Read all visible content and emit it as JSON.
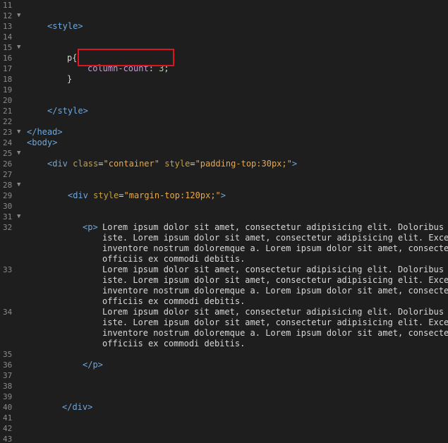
{
  "editor": {
    "lines": [
      {
        "num": "11",
        "fold": false
      },
      {
        "num": "12",
        "fold": true
      },
      {
        "num": "13",
        "fold": false
      },
      {
        "num": "14",
        "fold": false
      },
      {
        "num": "15",
        "fold": true
      },
      {
        "num": "16",
        "fold": false
      },
      {
        "num": "17",
        "fold": false
      },
      {
        "num": "18",
        "fold": false
      },
      {
        "num": "19",
        "fold": false
      },
      {
        "num": "20",
        "fold": false
      },
      {
        "num": "21",
        "fold": false
      },
      {
        "num": "22",
        "fold": false
      },
      {
        "num": "23",
        "fold": true
      },
      {
        "num": "24",
        "fold": false
      },
      {
        "num": "25",
        "fold": true
      },
      {
        "num": "26",
        "fold": false
      },
      {
        "num": "27",
        "fold": false
      },
      {
        "num": "28",
        "fold": true
      },
      {
        "num": "29",
        "fold": false
      },
      {
        "num": "30",
        "fold": false
      },
      {
        "num": "31",
        "fold": true
      },
      {
        "num": "32",
        "fold": false
      },
      {
        "num": "33",
        "fold": false
      },
      {
        "num": "34",
        "fold": false
      },
      {
        "num": "35",
        "fold": false
      },
      {
        "num": "36",
        "fold": false
      },
      {
        "num": "37",
        "fold": false
      },
      {
        "num": "38",
        "fold": false
      },
      {
        "num": "39",
        "fold": false
      },
      {
        "num": "40",
        "fold": false
      },
      {
        "num": "41",
        "fold": false
      },
      {
        "num": "42",
        "fold": false
      },
      {
        "num": "43",
        "fold": false
      }
    ],
    "fold_glyph": "▼",
    "code": {
      "style_open": "<style>",
      "p_selector": "p{",
      "prop_name": "column-count",
      "prop_colon": ": ",
      "prop_value": "3",
      "prop_semicolon": ";",
      "close_brace": "}",
      "style_close": "</style>",
      "head_close": "</head>",
      "body_open": "<body>",
      "div1_open_tag": "<div",
      "div1_attr1_name": " class",
      "div1_attr1_eq": "=",
      "div1_attr1_val": "\"container\"",
      "div1_attr2_name": " style",
      "div1_attr2_eq": "=",
      "div1_attr2_val": "\"padding-top:30px;\"",
      "div1_close_bracket": ">",
      "div2_open_tag": "<div",
      "div2_attr_name": " style",
      "div2_attr_eq": "=",
      "div2_attr_val": "\"margin-top:120px;\"",
      "div2_close_bracket": ">",
      "p_open": "<p>",
      "para_l1": "Lorem ipsum dolor sit amet, consectetur adipisicing elit. Doloribus",
      "para_l2": "iste. Lorem ipsum dolor sit amet, consectetur adipisicing elit. Exce",
      "para_l3": "inventore nostrum doloremque a. Lorem ipsum dolor sit amet, consecte",
      "para_l4": "officiis ex commodi debitis.",
      "p_close": "</p>",
      "div_close": "</div>"
    }
  }
}
